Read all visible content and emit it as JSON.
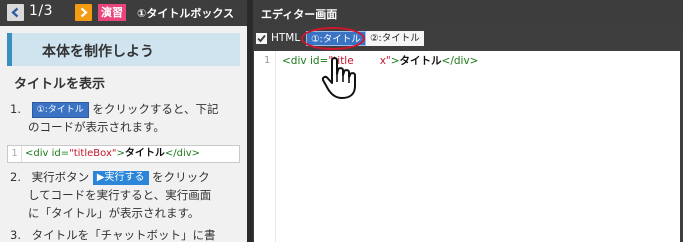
{
  "topbar": {
    "page_counter": "1/3",
    "mode_badge": "演習",
    "lesson_title": "①タイトルボックス",
    "prev_icon": "chevron-left-icon",
    "next_icon": "chevron-right-icon"
  },
  "tutorial": {
    "section_title": "本体を制作しよう",
    "subheading": "タイトルを表示",
    "steps": [
      {
        "num": "1.",
        "chip": "①:タイトル",
        "line1_after": "をクリックすると、下記",
        "line2": "のコードが表示されます。"
      },
      {
        "num": "2.",
        "line1_before": "実行ボタン",
        "chip": "▶実行する",
        "line1_after": "をクリック",
        "line2": "してコードを実行すると、実行画面",
        "line3": "に「タイトル」が表示されます。"
      },
      {
        "num": "3.",
        "line1": "タイトルを「チャットボット」に書"
      }
    ],
    "snippet": {
      "line_number": "1",
      "tag_open": "<div ",
      "attr": "id=",
      "string": "\"titleBox\"",
      "close": ">",
      "text": "タイトル",
      "tag_close": "</div>"
    }
  },
  "editor": {
    "title": "エディター画面",
    "language_label": "HTML",
    "tabs": [
      {
        "label": "①:タイトル",
        "active": true
      },
      {
        "label": "②:タイトル",
        "active": false
      }
    ],
    "code": {
      "line_number": "1",
      "tag_open": "<div ",
      "attr": "id=",
      "string_visible": "\"title",
      "string_tail": "x\"",
      "close": ">",
      "text": "タイトル",
      "tag_close": "</div>"
    }
  },
  "colors": {
    "topbar_bg": "#3d3d3d",
    "next_button": "#f39c12",
    "mode_badge": "#e8457a",
    "section_banner": "#cfe4ef",
    "active_tab": "#3a73c4",
    "highlight_ring": "#d0152e"
  }
}
